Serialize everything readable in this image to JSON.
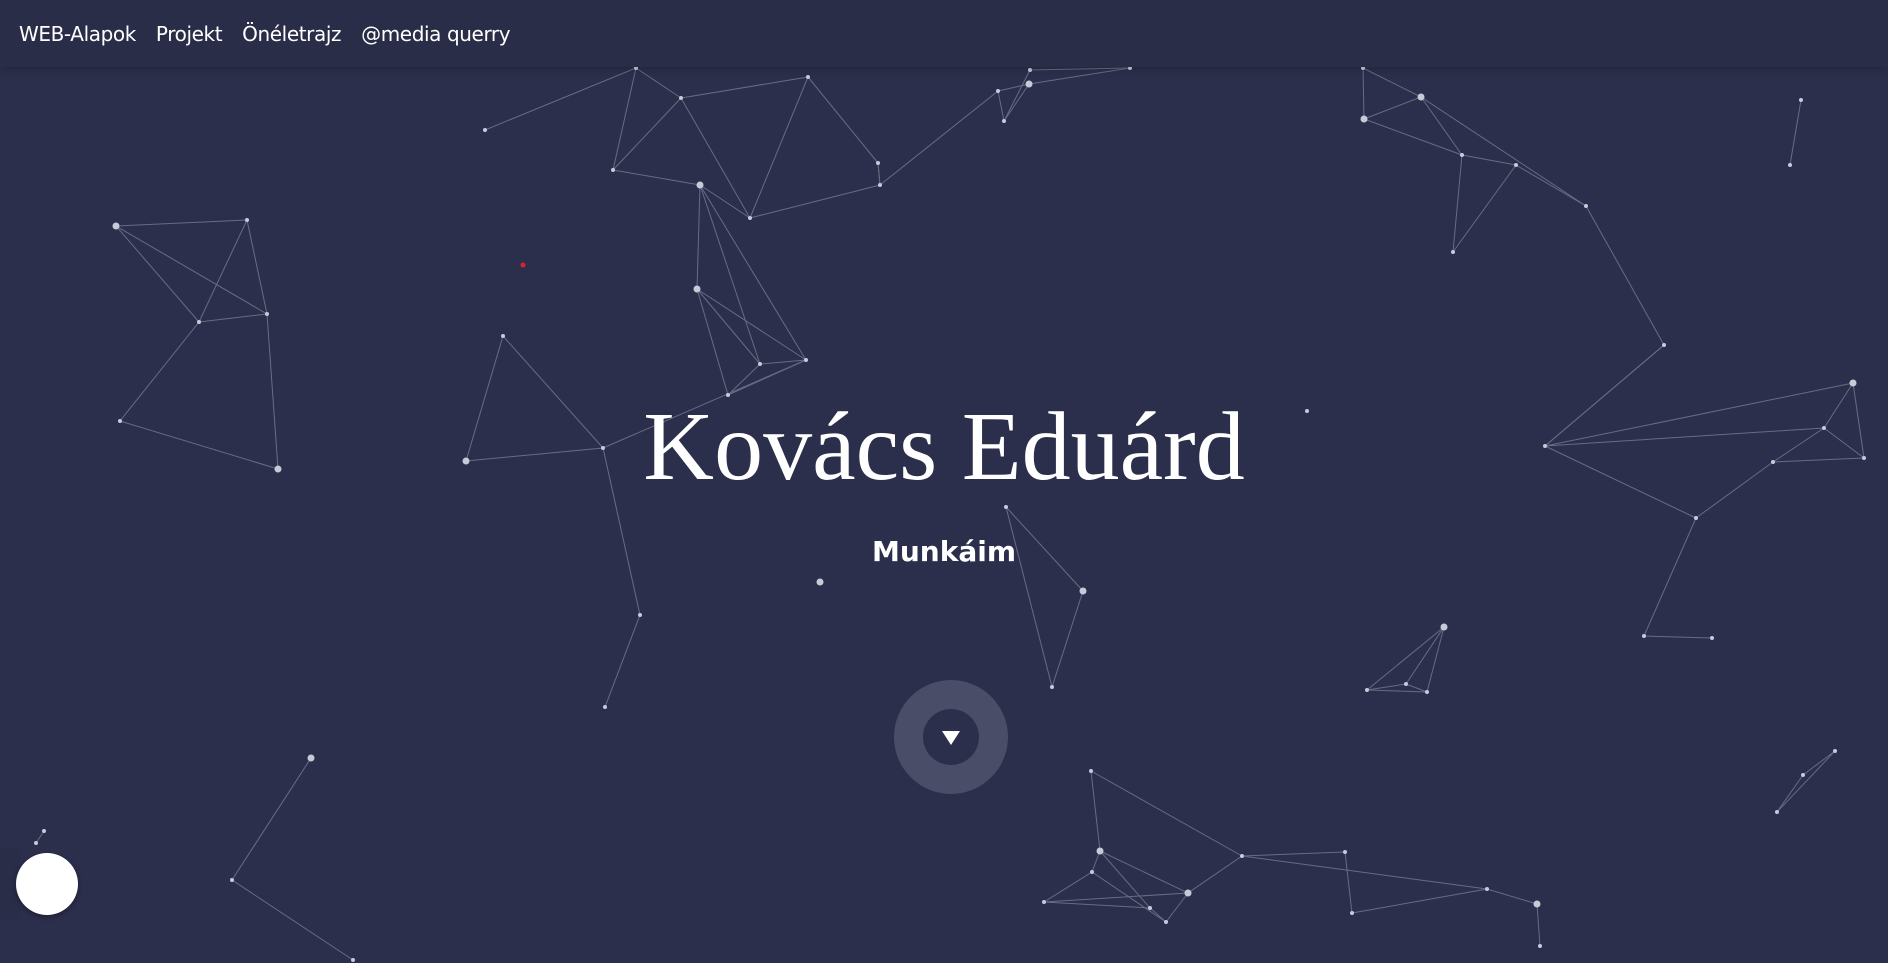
{
  "nav": {
    "items": [
      {
        "label": "WEB-Alapok"
      },
      {
        "label": "Projekt"
      },
      {
        "label": "Önéletrajz"
      },
      {
        "label": "@media querry"
      }
    ]
  },
  "hero": {
    "title": "Kovács Eduárd",
    "subtitle": "Munkáim"
  },
  "scroll_button": {
    "icon": "triangle-down-icon"
  },
  "theme_toggle": {
    "icon": "circle-toggle"
  },
  "colors": {
    "background": "#2c2f4c",
    "navbar": "#2a2d47",
    "text": "#ffffff",
    "particle_line": "#8a8ca6",
    "accent_dot": "#e0202e"
  }
}
